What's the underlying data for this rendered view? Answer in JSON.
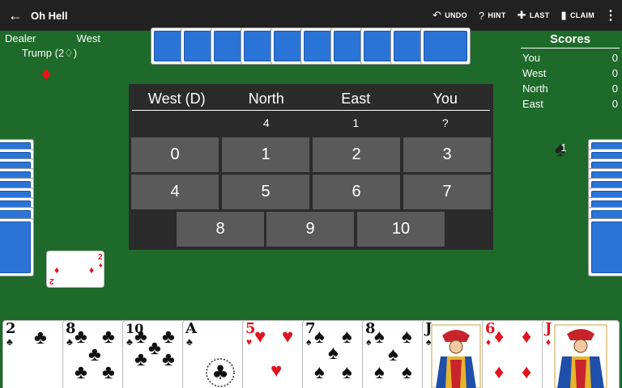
{
  "appbar": {
    "back_icon": "arrow-left-icon",
    "title": "Oh Hell",
    "actions": [
      {
        "icon": "undo-icon",
        "label": "UNDO"
      },
      {
        "icon": "help-icon",
        "label": "HINT"
      },
      {
        "icon": "last-trick-icon",
        "label": "LAST"
      },
      {
        "icon": "claim-icon",
        "label": "CLAIM"
      }
    ],
    "more_icon": "more-vert-icon"
  },
  "dealer": {
    "label": "Dealer",
    "name": "West",
    "trump_text": "Trump (2♢)",
    "trump_suit": "♦"
  },
  "scores": {
    "title": "Scores",
    "rows": [
      {
        "player": "You",
        "score": "0"
      },
      {
        "player": "West",
        "score": "0"
      },
      {
        "player": "North",
        "score": "0"
      },
      {
        "player": "East",
        "score": "0"
      }
    ]
  },
  "bidding": {
    "headers": [
      "West (D)",
      "North",
      "East",
      "You"
    ],
    "bids": [
      "",
      "4",
      "1",
      "?"
    ],
    "options": [
      "0",
      "1",
      "2",
      "3",
      "4",
      "5",
      "6",
      "7",
      "8",
      "9",
      "10"
    ]
  },
  "east_tricks": "1",
  "trump_card": {
    "rank": "2",
    "suit": "♦"
  },
  "hand": [
    {
      "rank": "2",
      "suit": "♣",
      "color": "black"
    },
    {
      "rank": "8",
      "suit": "♣",
      "color": "black"
    },
    {
      "rank": "10",
      "suit": "♣",
      "color": "black"
    },
    {
      "rank": "A",
      "suit": "♣",
      "color": "black"
    },
    {
      "rank": "5",
      "suit": "♥",
      "color": "red"
    },
    {
      "rank": "7",
      "suit": "♠",
      "color": "black"
    },
    {
      "rank": "8",
      "suit": "♠",
      "color": "black"
    },
    {
      "rank": "J",
      "suit": "♠",
      "color": "black"
    },
    {
      "rank": "6",
      "suit": "♦",
      "color": "red"
    },
    {
      "rank": "J",
      "suit": "♦",
      "color": "red"
    }
  ],
  "colors": {
    "felt": "#1e6a2a",
    "appbar": "#212121",
    "card_back": "#2a74d8",
    "panel": "#2b2b2b",
    "button": "#5a5a5a"
  }
}
